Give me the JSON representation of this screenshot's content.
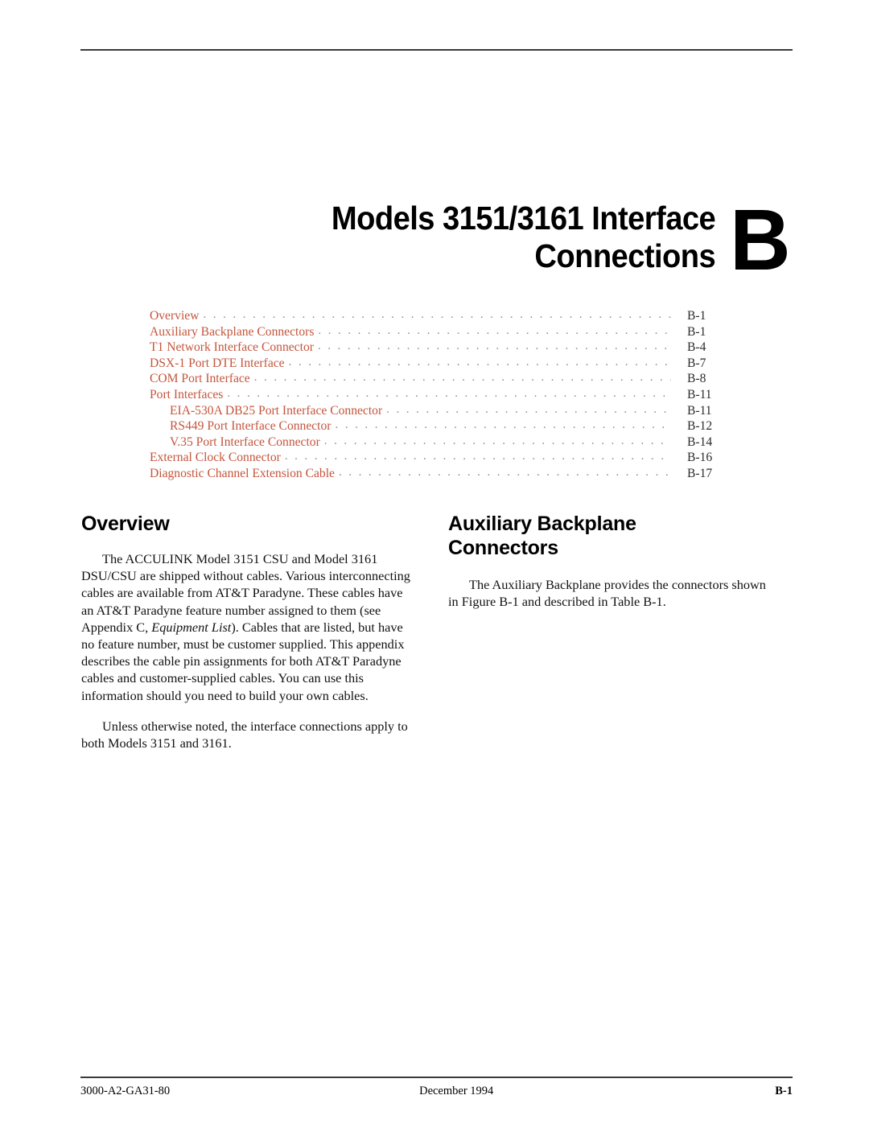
{
  "document": {
    "chapter_letter": "B",
    "title_line_1": "Models 3151/3161 Interface",
    "title_line_2": "Connections"
  },
  "toc": {
    "entries": [
      {
        "label": "Overview",
        "page": "B-1",
        "level": 1
      },
      {
        "label": "Auxiliary Backplane Connectors",
        "page": "B-1",
        "level": 1
      },
      {
        "label": "T1 Network Interface Connector",
        "page": "B-4",
        "level": 1
      },
      {
        "label": "DSX-1 Port DTE Interface",
        "page": "B-7",
        "level": 1
      },
      {
        "label": "COM Port Interface",
        "page": "B-8",
        "level": 1
      },
      {
        "label": "Port Interfaces",
        "page": "B-11",
        "level": 1
      },
      {
        "label": "EIA-530A DB25 Port Interface Connector",
        "page": "B-11",
        "level": 2
      },
      {
        "label": "RS449 Port Interface Connector",
        "page": "B-12",
        "level": 2
      },
      {
        "label": "V.35 Port Interface Connector",
        "page": "B-14",
        "level": 2
      },
      {
        "label": "External Clock Connector",
        "page": "B-16",
        "level": 1
      },
      {
        "label": "Diagnostic Channel Extension Cable",
        "page": "B-17",
        "level": 1
      }
    ],
    "leader": ". . . . . . . . . . . . . . . . . . . . . . . . . . . . . . . . . . . . . . . . . . . . . . . . . . . . . . . . . . . . . . . . . . . . . . . . . . . . . . . . . . . . . . . . . . . . . . . . ."
  },
  "left_column": {
    "heading": "Overview",
    "paragraph_1_part_1": "The ACCULINK Model 3151 CSU and Model 3161 DSU/CSU are shipped without cables. Various interconnecting cables are available from AT&T Paradyne. These cables have an AT&T Paradyne feature number assigned to them (see Appendix C, ",
    "paragraph_1_italic_1": "Equipment List",
    "paragraph_1_part_2": "). Cables that are listed, but have no feature number, must be customer supplied. This appendix describes the cable pin assignments for both AT&T Paradyne cables and customer-supplied cables. You can use this information should you need to build your own cables.",
    "paragraph_2": "Unless otherwise noted, the interface connections apply to both Models 3151 and 3161."
  },
  "right_column": {
    "heading_line_1": "Auxiliary Backplane",
    "heading_line_2": "Connectors",
    "paragraph_1": "The Auxiliary Backplane provides the connectors shown in Figure B-1 and described in Table B-1."
  },
  "footer": {
    "document_number": "3000-A2-GA31-80",
    "date": "December 1994",
    "page_number": "B-1"
  },
  "colors": {
    "toc_link": "#c4553c",
    "rule": "#3a3a3a",
    "text": "#000000"
  }
}
